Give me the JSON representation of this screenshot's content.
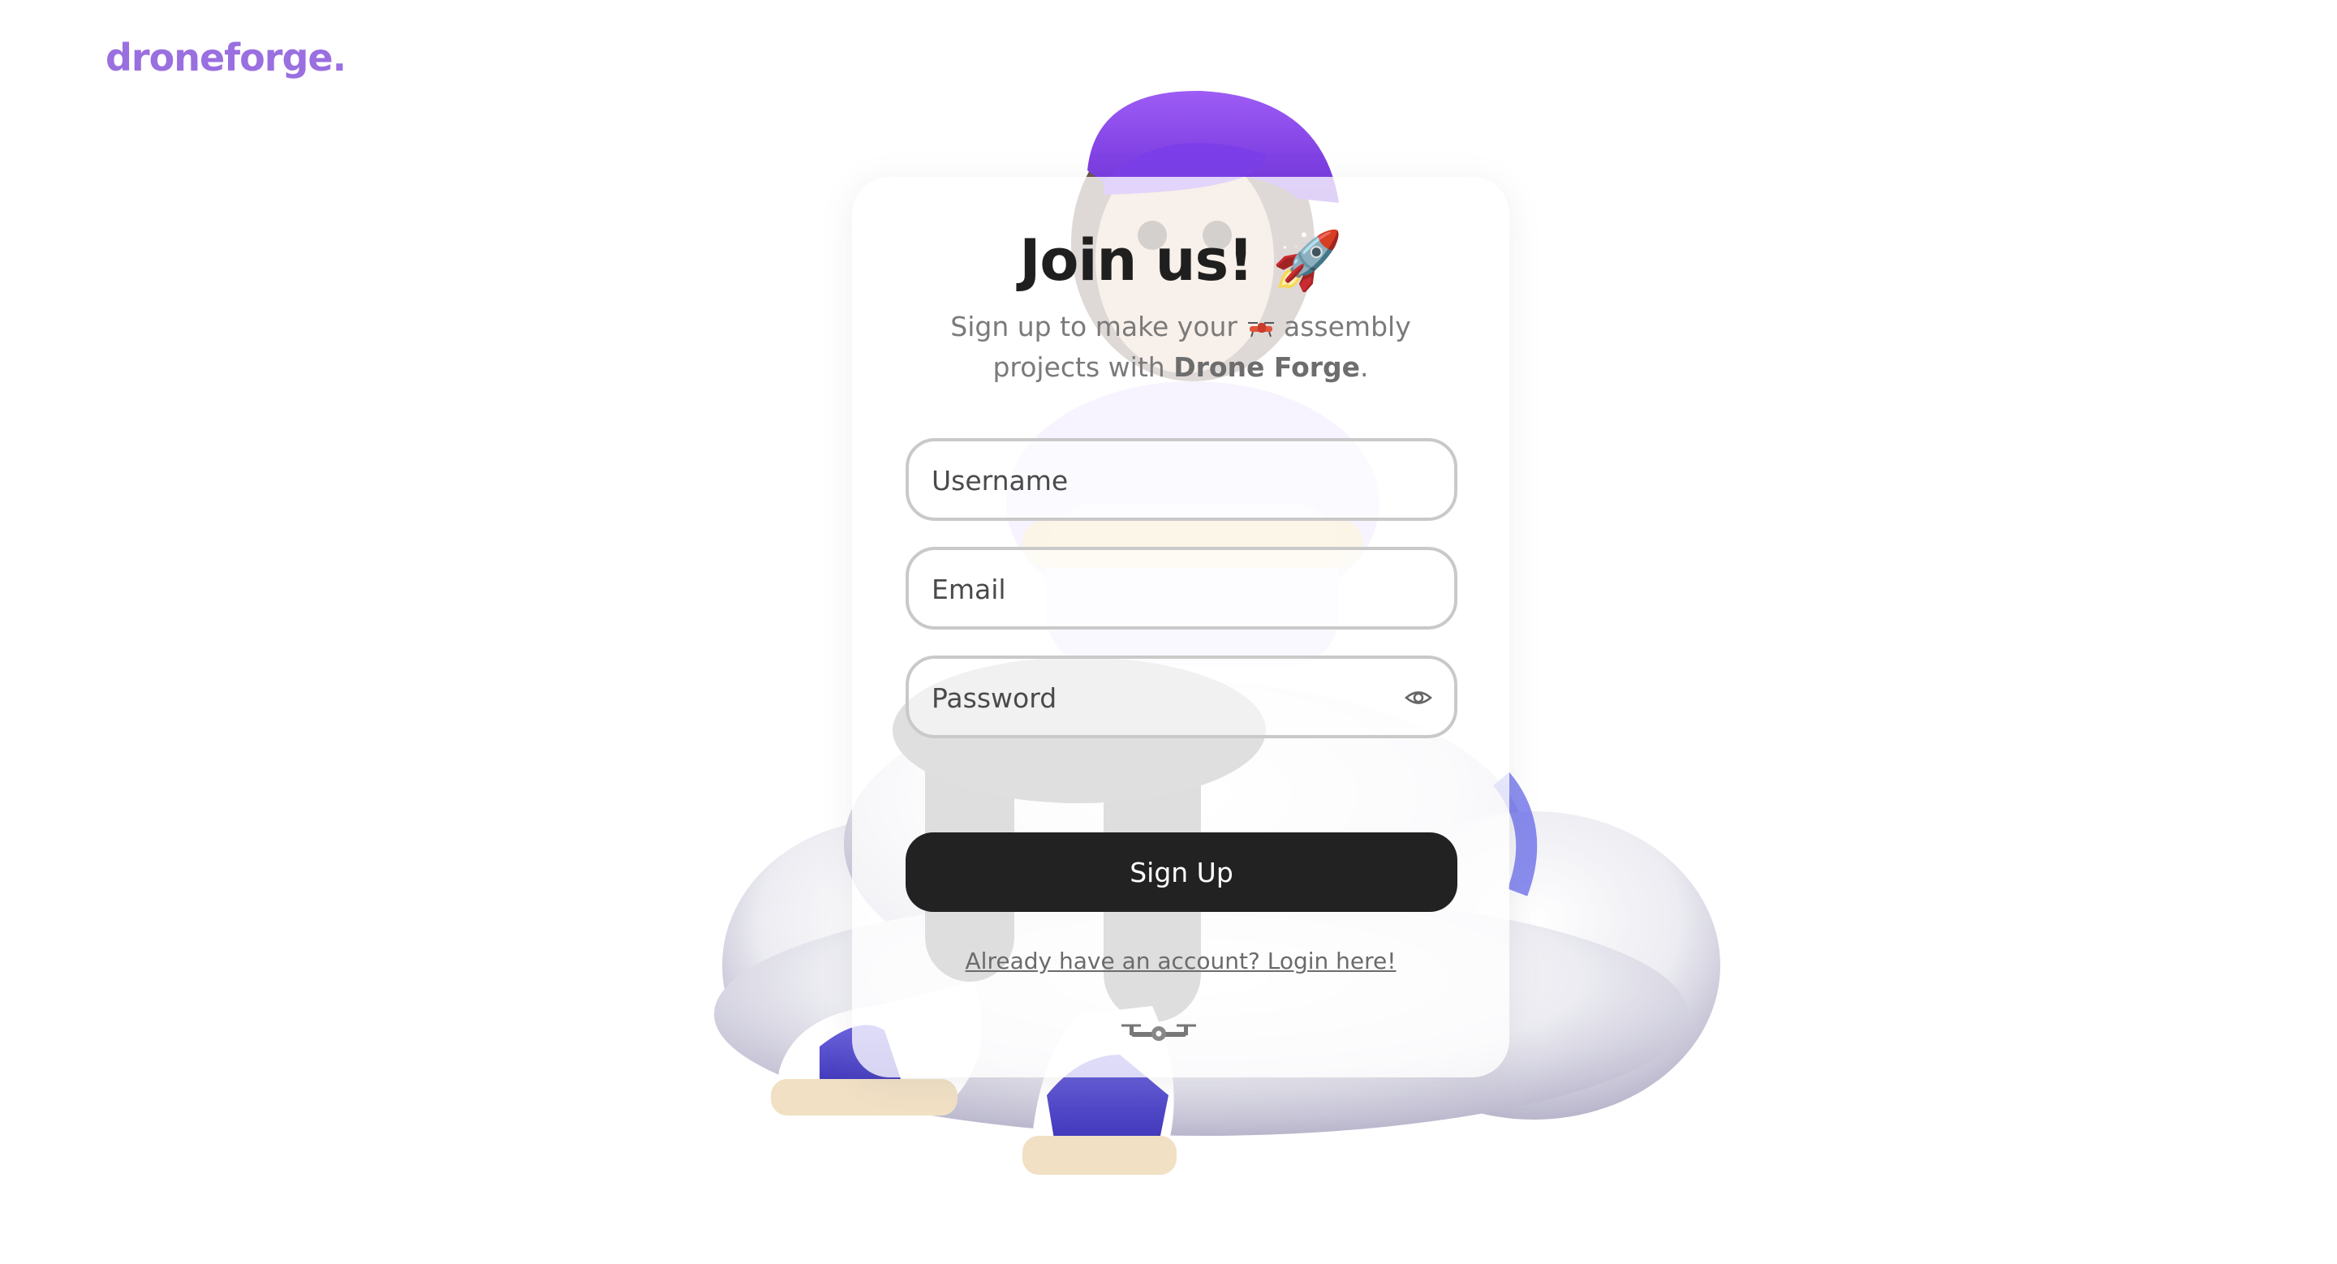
{
  "brand": {
    "logo_text": "droneforge.",
    "color": "#9a6fe0"
  },
  "card": {
    "title": "Join us! 🚀",
    "subtitle_part1": "Sign up to make your",
    "subtitle_part2": "assembly",
    "subtitle_part3": "projects with",
    "subtitle_brand": "Drone Forge",
    "subtitle_end": "."
  },
  "form": {
    "username_placeholder": "Username",
    "email_placeholder": "Email",
    "password_placeholder": "Password",
    "submit_label": "Sign Up",
    "login_link": "Already have an account? Login here!"
  },
  "icons": {
    "subtitle_icon": "drone-emoji-icon",
    "password_toggle": "eye-icon",
    "footer_icon": "drone-icon",
    "illustration": "character-on-cloud-illustration"
  },
  "colors": {
    "button_bg": "#222222",
    "button_text": "#ffffff",
    "field_border": "#c9c9c9",
    "accent_purple": "#8a5cf0"
  }
}
